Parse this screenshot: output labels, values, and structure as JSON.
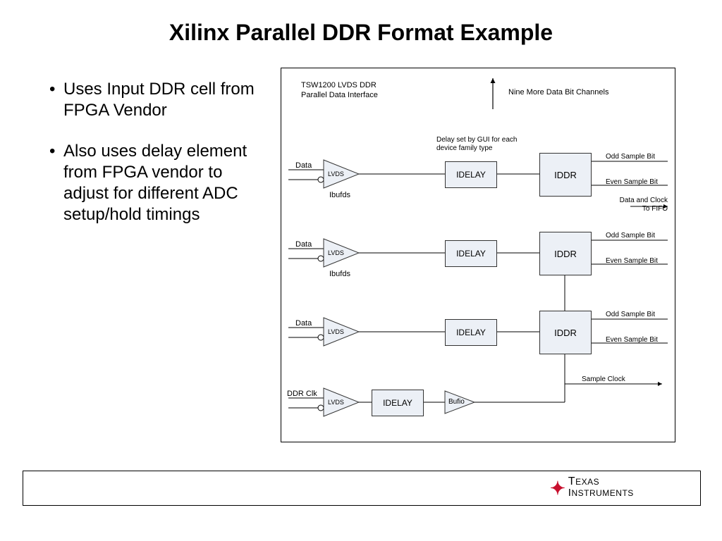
{
  "title": "Xilinx Parallel DDR Format Example",
  "bullets": [
    "Uses Input DDR cell from FPGA Vendor",
    "Also uses delay element from FPGA vendor to adjust for different ADC setup/hold timings"
  ],
  "diagram": {
    "header_left_1": "TSW1200 LVDS DDR",
    "header_left_2": "Parallel Data Interface",
    "header_right": "Nine More Data Bit Channels",
    "delay_note_1": "Delay set by GUI for each",
    "delay_note_2": "device family type",
    "data_label": "Data",
    "ddr_clk_label": "DDR Clk",
    "lvds": "LVDS",
    "ibufds": "Ibufds",
    "idelay": "IDELAY",
    "iddr": "IDDR",
    "bufio": "Bufio",
    "odd": "Odd Sample Bit",
    "even": "Even Sample Bit",
    "fifo_1": "Data and Clock",
    "fifo_2": "To FIFO",
    "sample_clock": "Sample Clock"
  },
  "footer_brand": "TEXAS INSTRUMENTS"
}
